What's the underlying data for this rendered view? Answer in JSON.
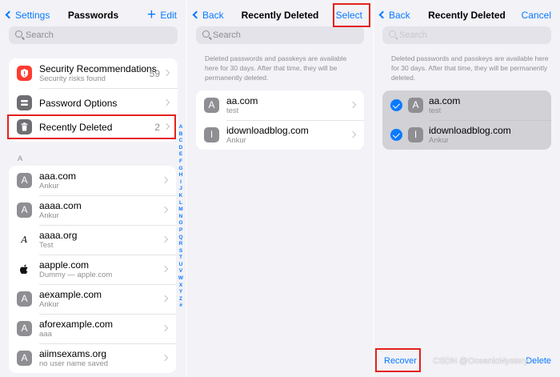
{
  "colors": {
    "accent": "#0a7aff",
    "highlight": "#e5201c",
    "background": "#f2f2f7"
  },
  "panel1": {
    "back_label": "Settings",
    "title": "Passwords",
    "add_icon": "plus-icon",
    "edit_label": "Edit",
    "search_placeholder": "Search",
    "security": {
      "title": "Security Recommendations",
      "subtitle": "Security risks found",
      "count": "59"
    },
    "options": {
      "title": "Password Options"
    },
    "recently_deleted": {
      "title": "Recently Deleted",
      "count": "2"
    },
    "section_letter": "A",
    "entries": [
      {
        "tile": "A",
        "title": "aaa.com",
        "subtitle": "Ankur"
      },
      {
        "tile": "A",
        "title": "aaaa.com",
        "subtitle": "Ankur"
      },
      {
        "tile": "A",
        "title": "aaaa.org",
        "subtitle": "Test"
      },
      {
        "tile": "",
        "title": "aapple.com",
        "subtitle": "Dummy — apple.com"
      },
      {
        "tile": "A",
        "title": "aexample.com",
        "subtitle": "Ankur"
      },
      {
        "tile": "A",
        "title": "aforexample.com",
        "subtitle": "aaa"
      },
      {
        "tile": "A",
        "title": "aiimsexams.org",
        "subtitle": "no user name saved"
      }
    ],
    "index_letters": [
      "A",
      "B",
      "C",
      "D",
      "E",
      "F",
      "G",
      "H",
      "I",
      "J",
      "K",
      "L",
      "M",
      "N",
      "O",
      "P",
      "Q",
      "R",
      "S",
      "T",
      "U",
      "V",
      "W",
      "X",
      "Y",
      "Z",
      "#"
    ]
  },
  "panel2": {
    "back_label": "Back",
    "title": "Recently Deleted",
    "select_label": "Select",
    "search_placeholder": "Search",
    "info": "Deleted passwords and passkeys are available here for 30 days. After that time, they will be permanently deleted.",
    "entries": [
      {
        "tile": "A",
        "title": "aa.com",
        "subtitle": "test"
      },
      {
        "tile": "I",
        "title": "idownloadblog.com",
        "subtitle": "Ankur"
      }
    ]
  },
  "panel3": {
    "back_label": "Back",
    "title": "Recently Deleted",
    "cancel_label": "Cancel",
    "search_placeholder": "Search",
    "info": "Deleted passwords and passkeys are available here for 30 days. After that time, they will be permanently deleted.",
    "entries": [
      {
        "tile": "A",
        "title": "aa.com",
        "subtitle": "test",
        "selected": true
      },
      {
        "tile": "I",
        "title": "idownloadblog.com",
        "subtitle": "Ankur",
        "selected": true
      }
    ],
    "recover_label": "Recover",
    "delete_label": "Delete"
  },
  "watermark": "CSDN @OceanicMystery"
}
